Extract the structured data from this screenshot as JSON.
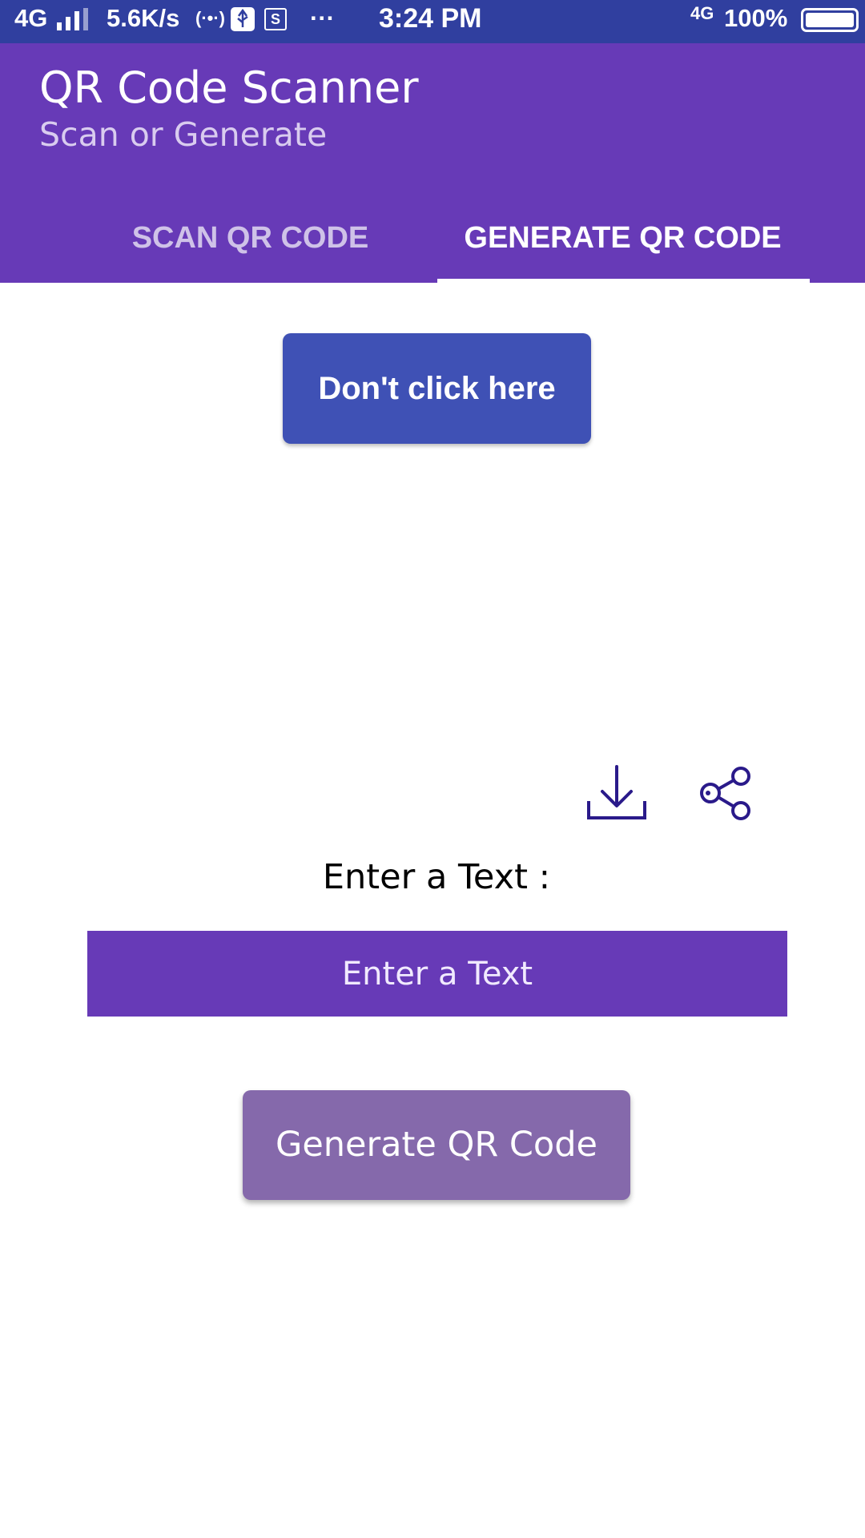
{
  "status_bar": {
    "network": "4G",
    "speed": "5.6K/s",
    "wifi_glyph": "(·•·)",
    "usb_icon": "usb-icon",
    "screenshot_icon_glyph": "S",
    "more": "···",
    "time": "3:24 PM",
    "network_right": "4G",
    "battery": "100%"
  },
  "app_bar": {
    "title": "QR Code Scanner",
    "subtitle": "Scan or Generate",
    "background": "#673ab7"
  },
  "tabs": [
    {
      "label": "SCAN QR CODE",
      "selected": false
    },
    {
      "label": "GENERATE QR CODE",
      "selected": true
    }
  ],
  "main": {
    "warning_button": "Don't click here",
    "download_icon": "download-icon",
    "share_icon": "share-icon",
    "prompt_label": "Enter a Text :",
    "text_input": {
      "value": "",
      "placeholder": "Enter a Text"
    },
    "generate_button": "Generate QR Code"
  },
  "colors": {
    "status_bar": "#303f9f",
    "primary": "#673ab7",
    "accent_button": "#3f51b5",
    "generate_button": "#8569ab",
    "icon_stroke": "#2a1a8a"
  }
}
